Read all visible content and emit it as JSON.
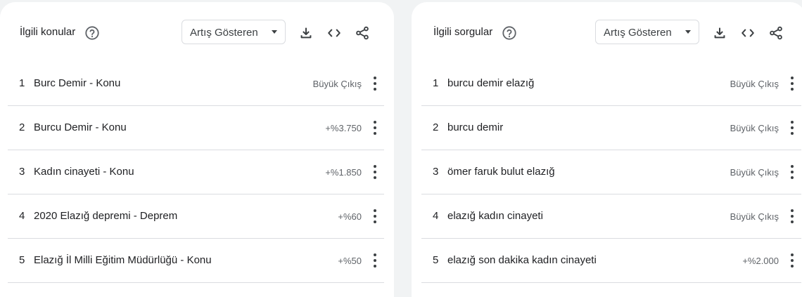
{
  "panels": [
    {
      "title": "İlgili konular",
      "dropdown_label": "Artış Gösteren",
      "rows": [
        {
          "index": "1",
          "label": "Burc Demir - Konu",
          "value": "Büyük Çıkış"
        },
        {
          "index": "2",
          "label": "Burcu Demir - Konu",
          "value": "+%3.750"
        },
        {
          "index": "3",
          "label": "Kadın cinayeti - Konu",
          "value": "+%1.850"
        },
        {
          "index": "4",
          "label": "2020 Elazığ depremi - Deprem",
          "value": "+%60"
        },
        {
          "index": "5",
          "label": "Elazığ İl Milli Eğitim Müdürlüğü - Konu",
          "value": "+%50"
        }
      ]
    },
    {
      "title": "İlgili sorgular",
      "dropdown_label": "Artış Gösteren",
      "rows": [
        {
          "index": "1",
          "label": "burcu demir elazığ",
          "value": "Büyük Çıkış"
        },
        {
          "index": "2",
          "label": "burcu demir",
          "value": "Büyük Çıkış"
        },
        {
          "index": "3",
          "label": "ömer faruk bulut elazığ",
          "value": "Büyük Çıkış"
        },
        {
          "index": "4",
          "label": "elazığ kadın cinayeti",
          "value": "Büyük Çıkış"
        },
        {
          "index": "5",
          "label": "elazığ son dakika kadın cinayeti",
          "value": "+%2.000"
        }
      ]
    }
  ],
  "icons": {
    "help": "help-circle-icon",
    "download": "download-icon",
    "embed": "code-embed-icon",
    "share": "share-icon",
    "menu": "more-vert-icon"
  }
}
